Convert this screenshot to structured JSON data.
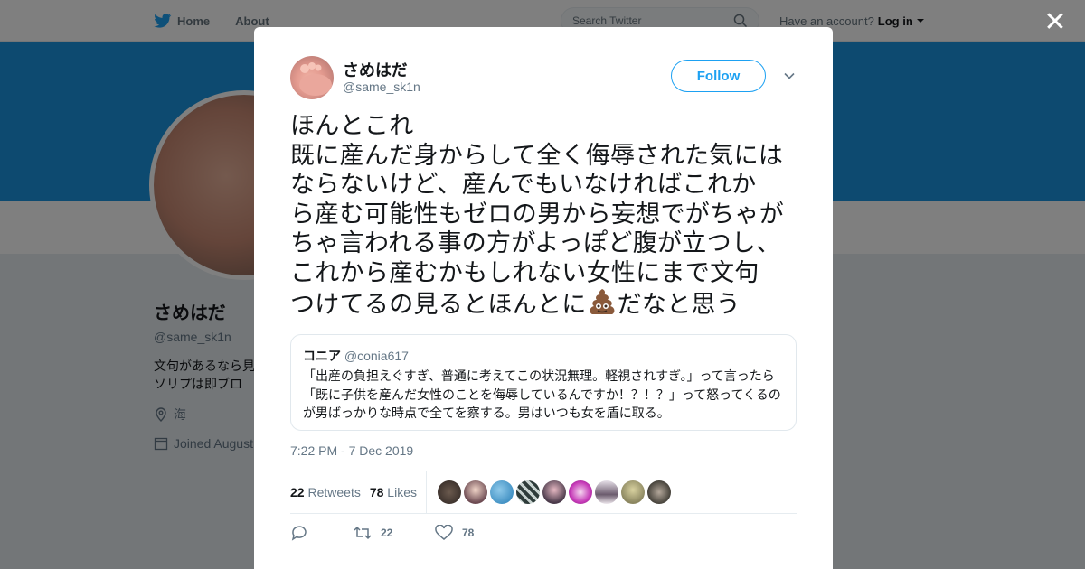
{
  "topbar": {
    "home_label": "Home",
    "about_label": "About",
    "search_placeholder": "Search Twitter",
    "account_prompt": "Have an account?",
    "login_label": "Log in"
  },
  "profile": {
    "name": "さめはだ",
    "handle": "@same_sk1n",
    "bio_lines": [
      "文句があるなら見",
      "ソリプは即ブロ"
    ],
    "location": "海",
    "joined": "Joined August"
  },
  "tweet": {
    "author_name": "さめはだ",
    "author_handle": "@same_sk1n",
    "follow_label": "Follow",
    "text_lines": [
      "ほんとこれ",
      "既に産んだ身からして全く侮辱された気にはならないけど、産んでもいなければこれから産む可能性もゼロの男から妄想でがちゃがちゃ言われる事の方がよっぽど腹が立つし、これから産むかもしれない女性にまで文句つけてるの見るとほんとに",
      "だなと思う"
    ],
    "wrapped_lines": [
      "ほんとこれ",
      "既に産んだ身からして全く侮辱された気には",
      "ならないけど、産んでもいなければこれか",
      "ら産む可能性もゼロの男から妄想でがちゃが",
      "ちゃ言われる事の方がよっぽど腹が立つし、",
      "これから産むかもしれない女性にまで文句"
    ],
    "last_line_before_emoji": "つけてるの見るとほんとに",
    "last_line_after_emoji": "だなと思う",
    "emoji_icon": "pile-of-poo-icon",
    "timestamp": "7:22 PM - 7 Dec 2019"
  },
  "quote": {
    "name": "コニア",
    "handle": "@conia617",
    "lines": [
      "「出産の負担えぐすぎ、普通に考えてこの状況無理。軽視されすぎ。」って言ったら",
      "「既に子供を産んだ女性のことを侮辱しているんですか！？！？」って怒ってくるの",
      "が男ばっかりな時点で全てを察する。男はいつも女を盾に取る。"
    ]
  },
  "stats": {
    "retweets_count": "22",
    "retweets_label": "Retweets",
    "likes_count": "78",
    "likes_label": "Likes"
  },
  "actions": {
    "retweet_count": "22",
    "like_count": "78"
  },
  "colors": {
    "accent": "#1da1f2",
    "banner": "#1b95e0",
    "muted": "#657786"
  }
}
